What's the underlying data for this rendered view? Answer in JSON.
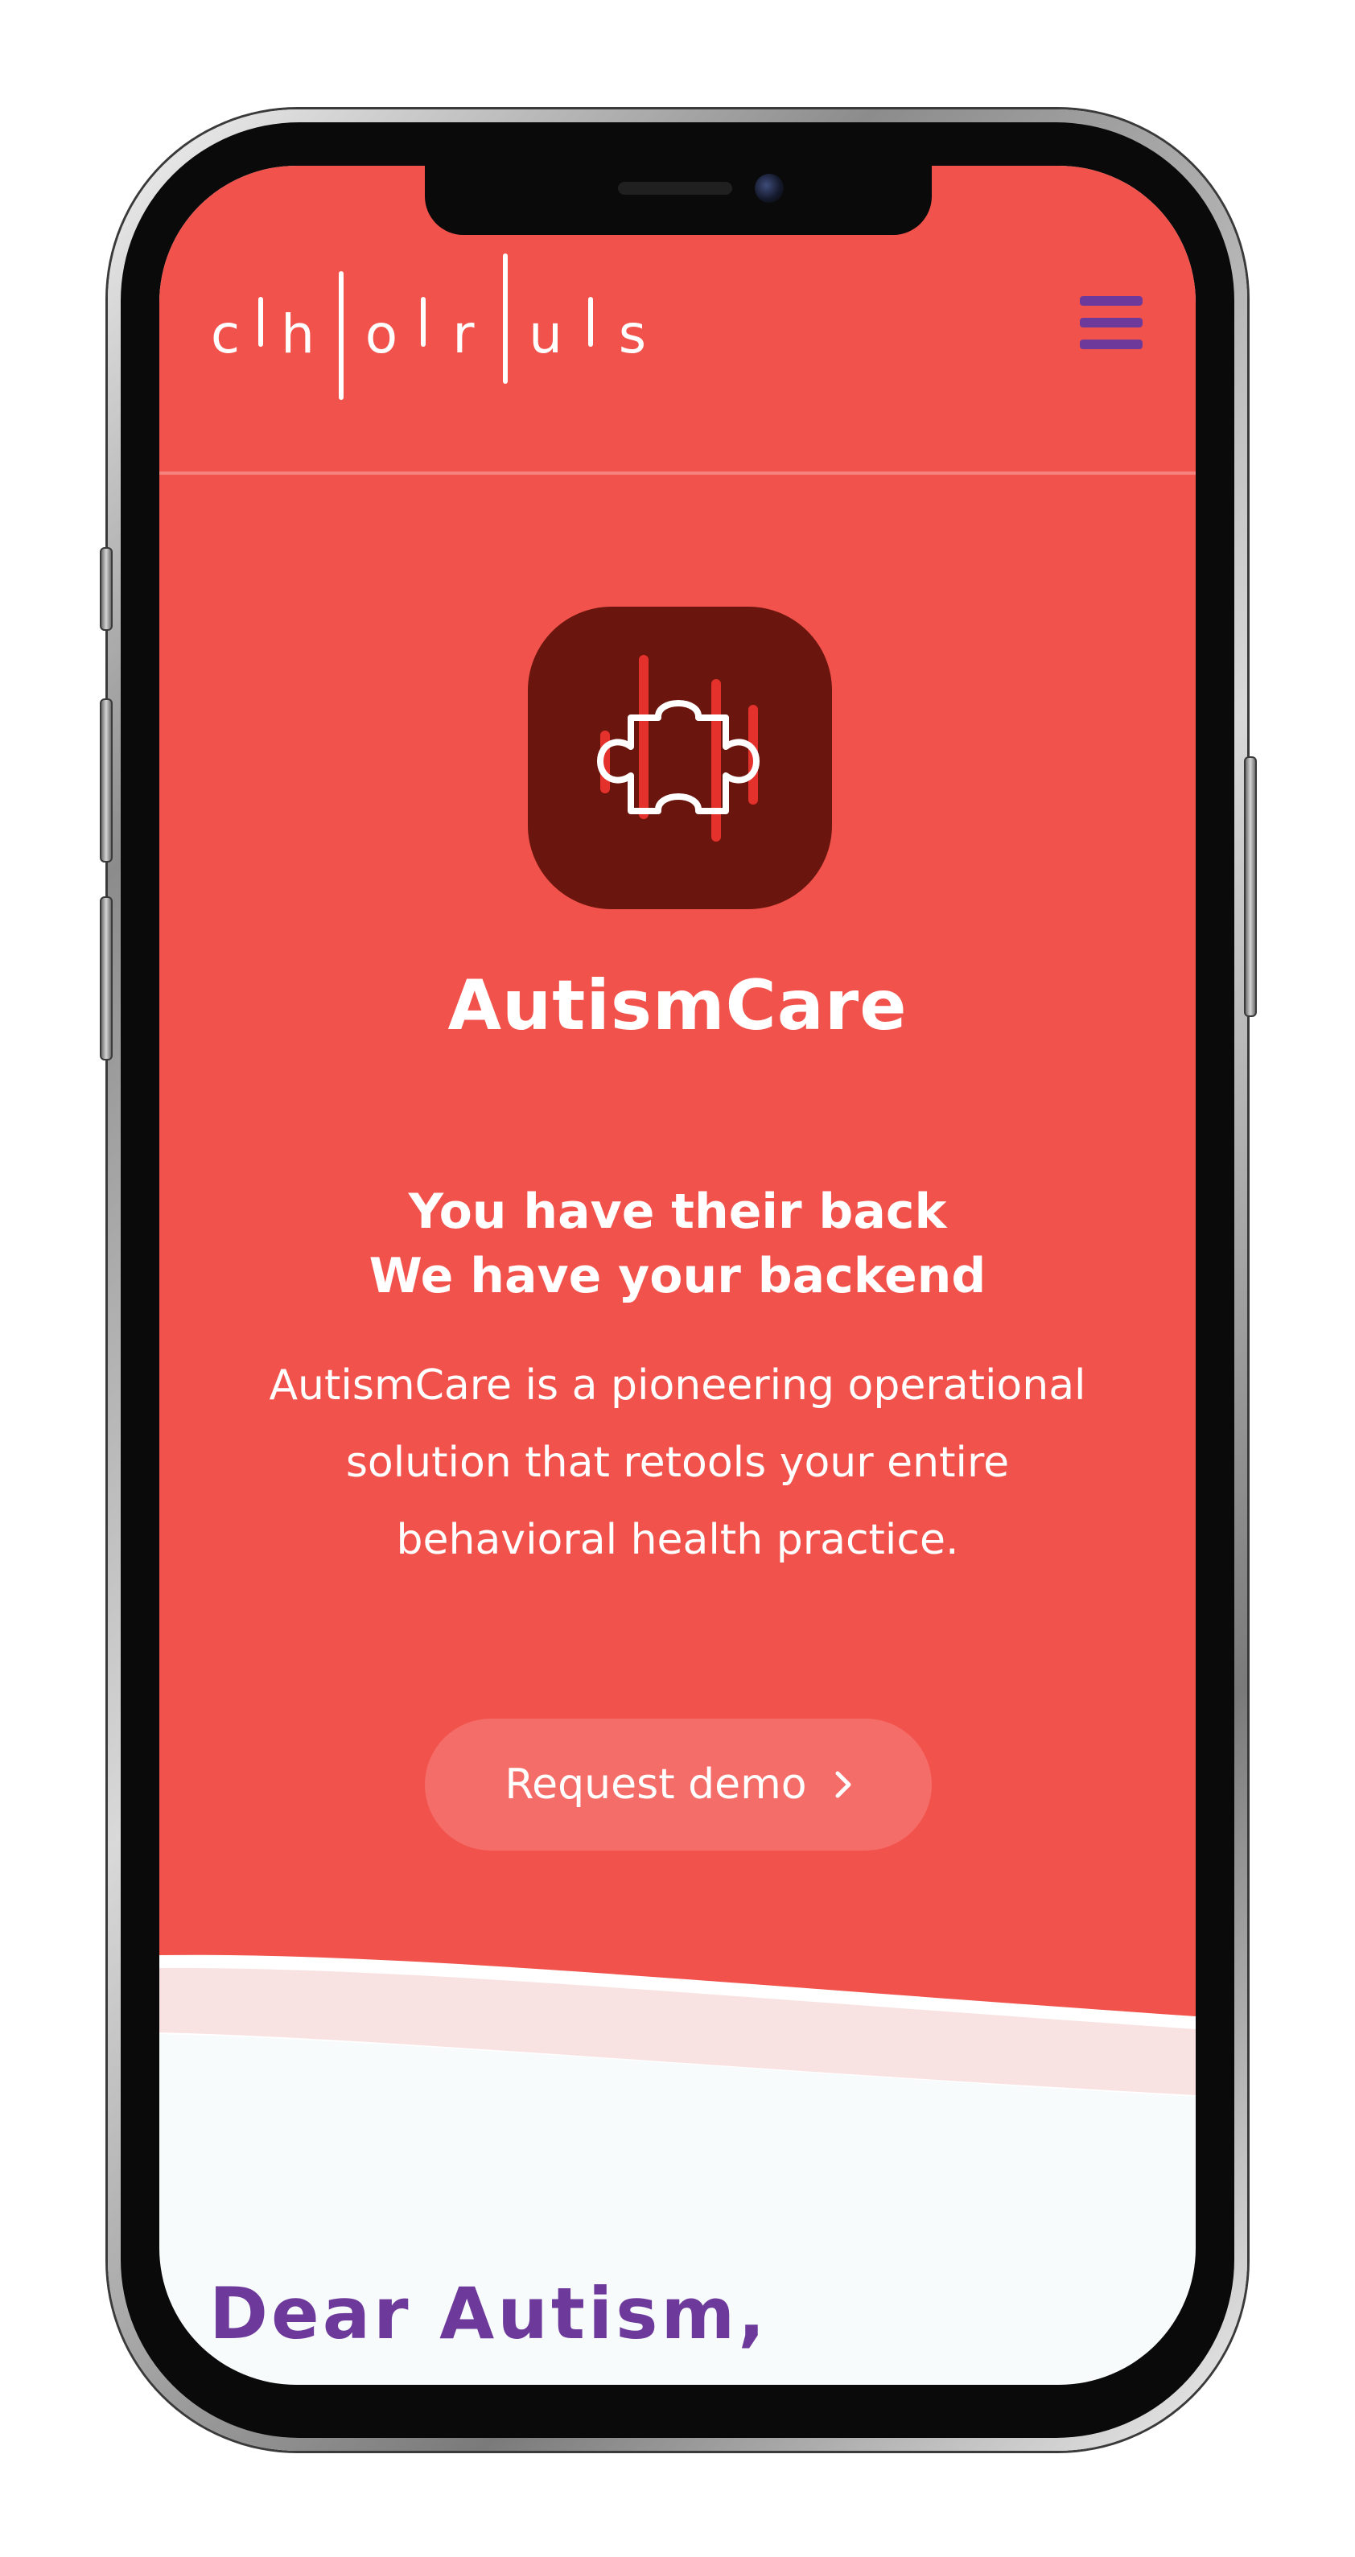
{
  "brand": {
    "logo_letters": [
      "c",
      "h",
      "o",
      "r",
      "u",
      "s"
    ],
    "logo_label": "chorus"
  },
  "header": {
    "menu_icon": "hamburger-menu-icon"
  },
  "hero": {
    "app_icon": "puzzle-piece-sound-bars-icon",
    "product_name": "AutismCare",
    "tagline_line1": "You have their back",
    "tagline_line2": "We have your backend",
    "description_line1": "AutismCare is a pioneering operational",
    "description_line2": "solution that retools your entire",
    "description_line3": "behavioral health practice.",
    "cta_label": "Request demo",
    "cta_icon": "chevron-right-icon"
  },
  "section": {
    "title": "Dear  Autism,"
  },
  "colors": {
    "hero_background": "#f2524c",
    "icon_tile": "#6a150d",
    "menu_accent": "#6d3a9c",
    "cta_background": "#f56d68",
    "page_background": "#f8fbfc"
  }
}
